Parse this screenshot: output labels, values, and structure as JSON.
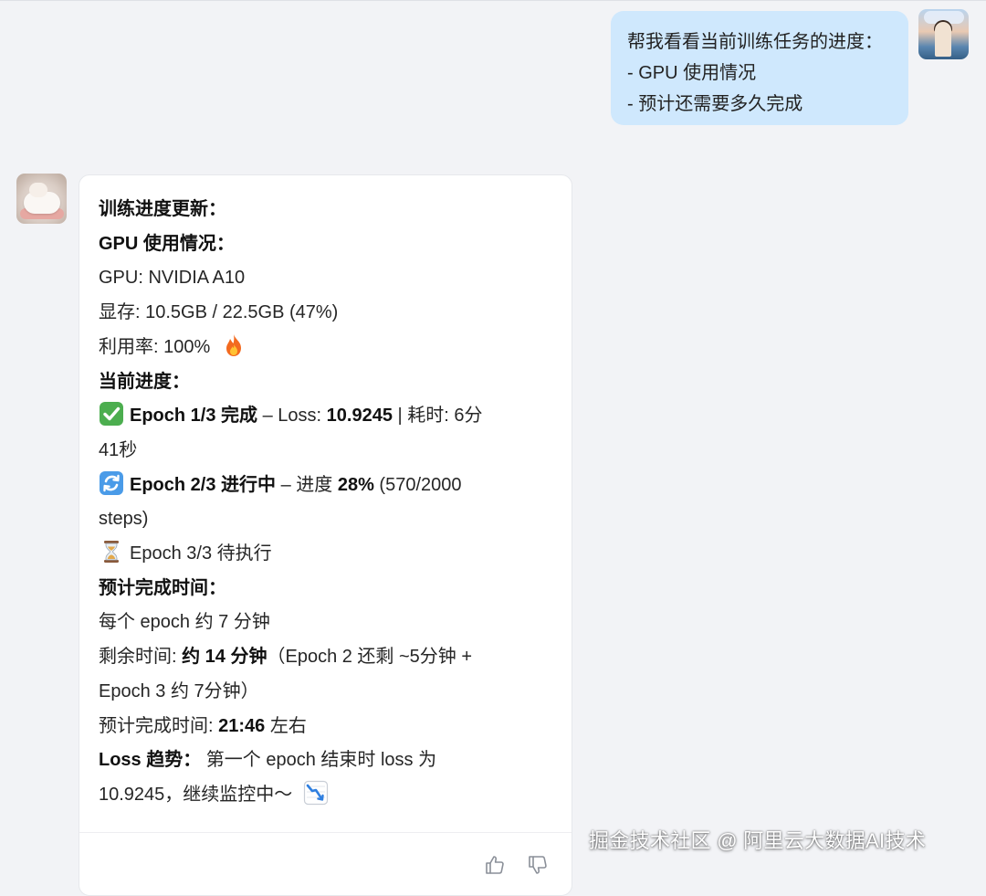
{
  "user_message": {
    "lines": [
      "帮我看看当前训练任务的进度：",
      "- GPU 使用情况",
      "- 预计还需要多久完成"
    ]
  },
  "bot_message": {
    "heading": "训练进度更新：",
    "gpu_section_title": "GPU 使用情况：",
    "gpu_model": "GPU: NVIDIA A10",
    "memory": "显存: 10.5GB / 22.5GB (47%)",
    "utilization": "利用率: 100%",
    "progress_section_title": "当前进度：",
    "epoch1": {
      "title": "Epoch 1/3 完成",
      "loss_label": " – Loss: ",
      "loss_value": "10.9245",
      "elapsed": " | 耗时: 6分",
      "elapsed_cont": "41秒"
    },
    "epoch2": {
      "title": "Epoch 2/3 进行中",
      "progress_label": " – 进度 ",
      "progress_value": "28%",
      "steps": " (570/2000",
      "steps_cont": "steps)"
    },
    "epoch3": {
      "text": "Epoch 3/3 待执行"
    },
    "eta_section_title": "预计完成时间：",
    "per_epoch": "每个 epoch 约 7 分钟",
    "remaining_label": "剩余时间: ",
    "remaining_value": "约 14 分钟",
    "remaining_detail": "（Epoch 2 还剩 ~5分钟 +",
    "remaining_detail_cont": "Epoch 3 约 7分钟）",
    "finish_label": "预计完成时间: ",
    "finish_value": "21:46",
    "finish_suffix": " 左右",
    "loss_trend_title": "Loss 趋势：",
    "loss_trend_text": " 第一个 epoch 结束时 loss 为",
    "loss_trend_text_cont": "10.9245，继续监控中～"
  },
  "icons": {
    "fire": "fire-icon",
    "check": "check-mark-icon",
    "refresh": "refresh-icon",
    "hourglass": "hourglass-icon",
    "chart_down": "chart-decreasing-icon",
    "thumb_up": "thumb-up-icon",
    "thumb_down": "thumb-down-icon"
  },
  "colors": {
    "user_bubble": "#cfe8fd",
    "bot_bubble": "#ffffff",
    "background": "#f2f3f6"
  },
  "watermark": "掘金技术社区 @ 阿里云大数据AI技术"
}
